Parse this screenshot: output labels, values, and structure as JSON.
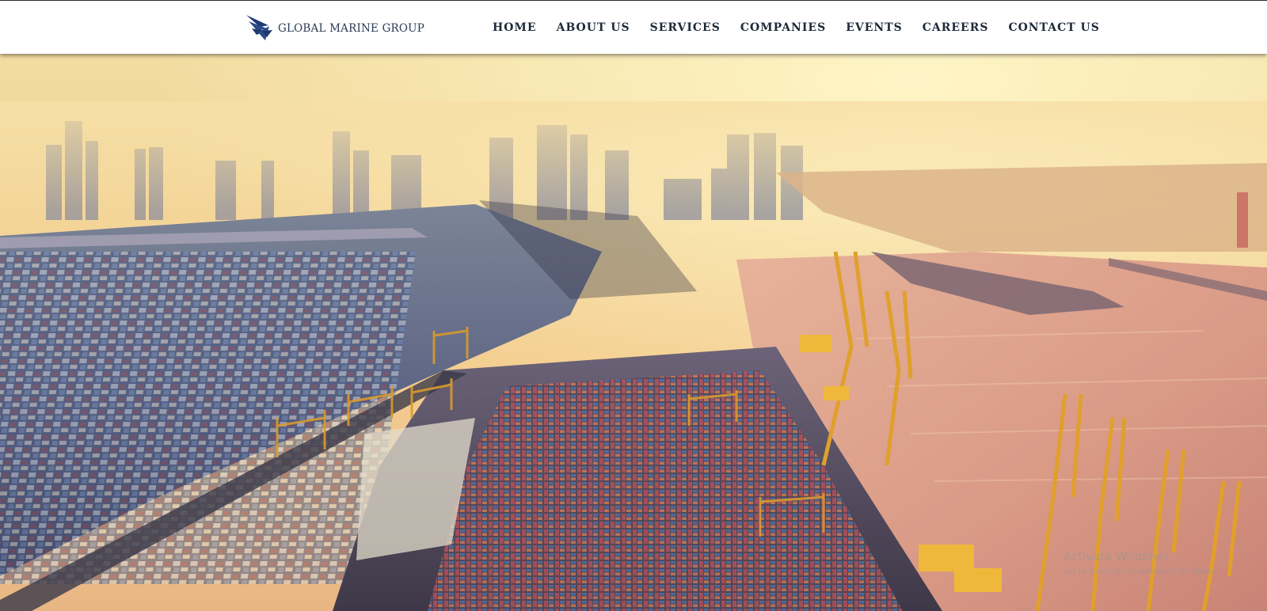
{
  "brand": {
    "name": "GLOBAL MARINE GROUP",
    "color": "#1f3a6e"
  },
  "nav": {
    "items": [
      {
        "label": "HOME"
      },
      {
        "label": "ABOUT US"
      },
      {
        "label": "SERVICES"
      },
      {
        "label": "COMPANIES"
      },
      {
        "label": "EVENTS"
      },
      {
        "label": "CAREERS"
      },
      {
        "label": "CONTACT US"
      }
    ]
  },
  "hero": {
    "image": "aerial-container-port-sunset-photo"
  },
  "watermark": {
    "title": "Activate Windows",
    "subtitle": "Go to Settings to activate Windows."
  }
}
